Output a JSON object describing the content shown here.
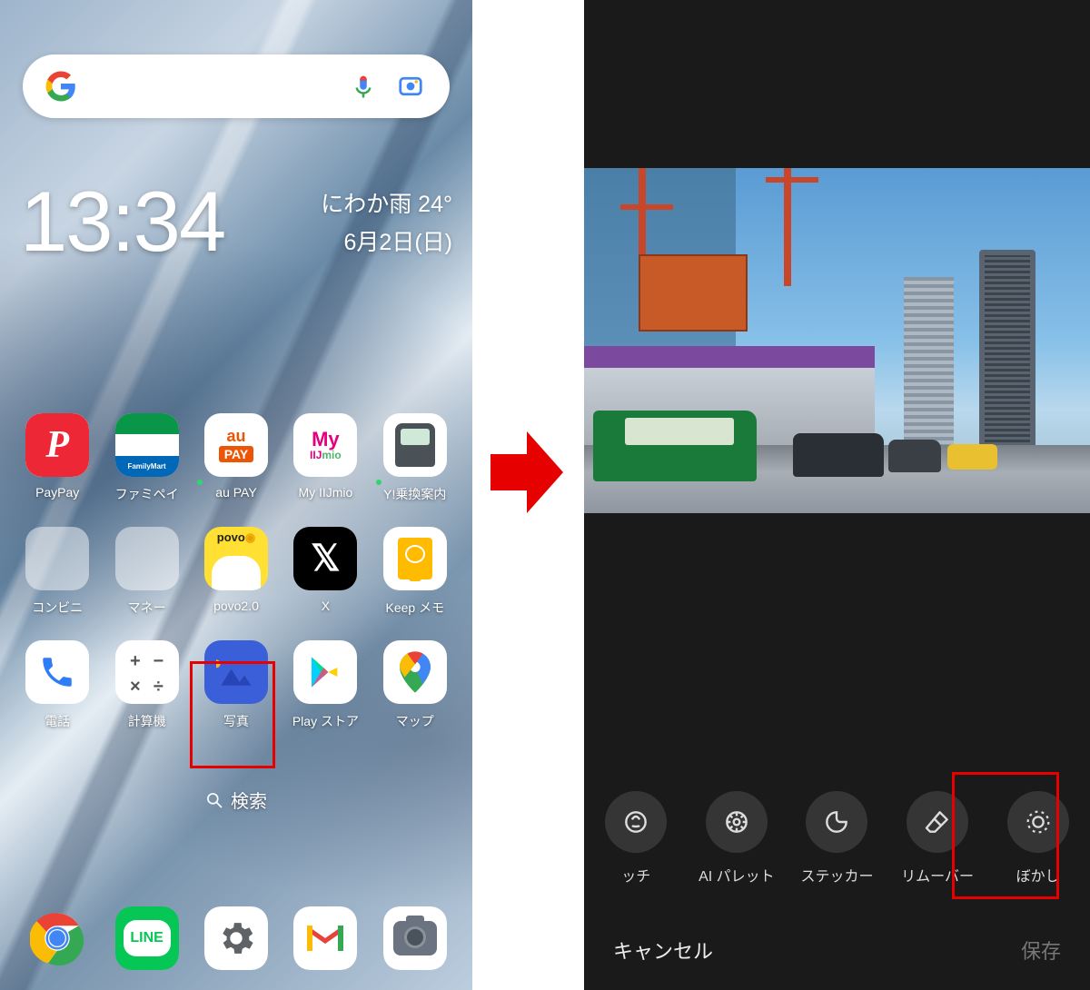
{
  "left": {
    "time": "13:34",
    "weather": {
      "line1": "にわか雨 24°",
      "line2": "6月2日(日)"
    },
    "search_pill": "検索",
    "apps": [
      {
        "label": "PayPay",
        "bg": "#fff",
        "render": "paypay"
      },
      {
        "label": "ファミペイ",
        "bg": "#fff",
        "render": "famima"
      },
      {
        "label": "au PAY",
        "bg": "#fff",
        "render": "aupay",
        "dot": true
      },
      {
        "label": "My IIJmio",
        "bg": "#fff",
        "render": "iij"
      },
      {
        "label": "Y!乗換案内",
        "bg": "#fff",
        "render": "train",
        "dot": true
      },
      {
        "label": "コンビニ",
        "bg": "folder",
        "render": "folder1"
      },
      {
        "label": "マネー",
        "bg": "folder",
        "render": "folder2"
      },
      {
        "label": "povo2.0",
        "bg": "#ffe033",
        "render": "povo"
      },
      {
        "label": "X",
        "bg": "#000",
        "render": "x"
      },
      {
        "label": "Keep メモ",
        "bg": "#fff",
        "render": "keep"
      },
      {
        "label": "電話",
        "bg": "#fff",
        "render": "phone"
      },
      {
        "label": "計算機",
        "bg": "#fff",
        "render": "calc"
      },
      {
        "label": "写真",
        "bg": "#3a5fd9",
        "render": "photos"
      },
      {
        "label": "Play ストア",
        "bg": "#fff",
        "render": "play"
      },
      {
        "label": "マップ",
        "bg": "#fff",
        "render": "maps"
      }
    ],
    "dock": [
      {
        "label": "",
        "render": "chrome"
      },
      {
        "label": "",
        "render": "line"
      },
      {
        "label": "",
        "render": "settings"
      },
      {
        "label": "",
        "render": "gmail"
      },
      {
        "label": "",
        "render": "camera"
      }
    ]
  },
  "right": {
    "tools": [
      {
        "label": "ッチ",
        "icon": "retouch"
      },
      {
        "label": "AI パレット",
        "icon": "palette"
      },
      {
        "label": "ステッカー",
        "icon": "sticker"
      },
      {
        "label": "リムーバー",
        "icon": "eraser"
      },
      {
        "label": "ぼかし",
        "icon": "blur"
      }
    ],
    "actions": {
      "cancel": "キャンセル",
      "save": "保存"
    }
  }
}
